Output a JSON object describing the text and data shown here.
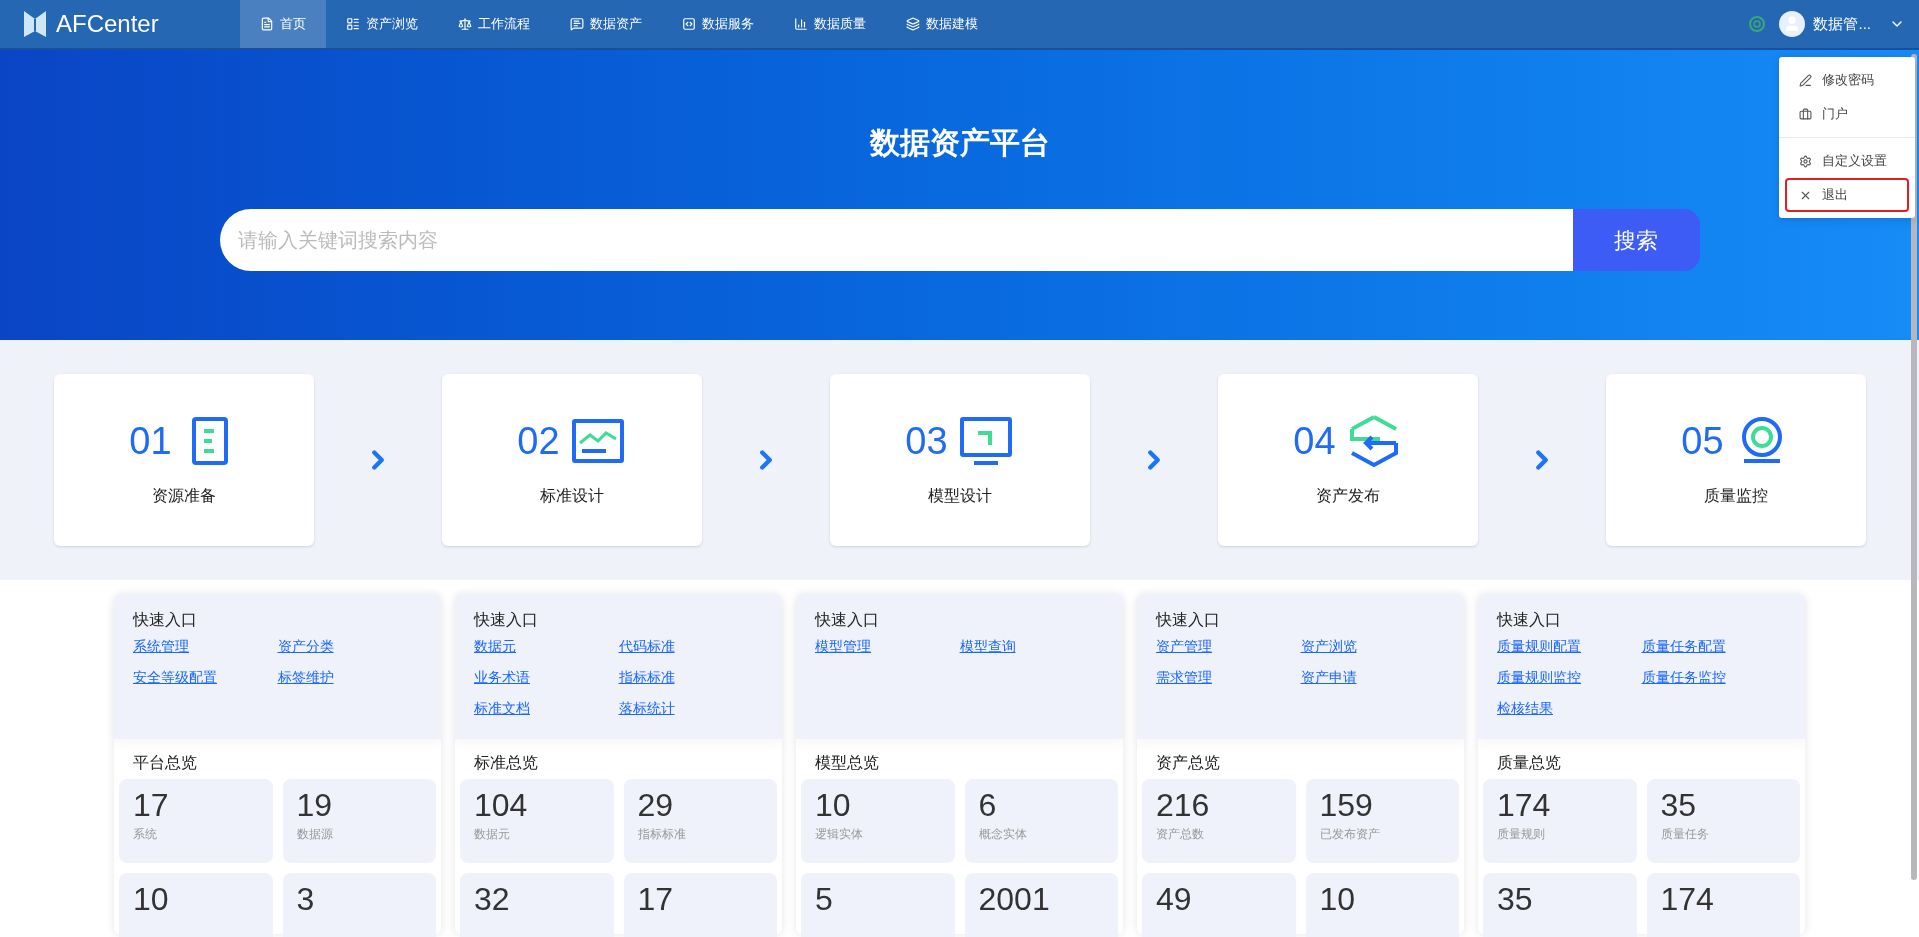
{
  "header": {
    "logo": "AFCenter",
    "nav": [
      {
        "label": "首页",
        "selected": true
      },
      {
        "label": "资产浏览",
        "selected": false
      },
      {
        "label": "工作流程",
        "selected": false
      },
      {
        "label": "数据资产",
        "selected": false
      },
      {
        "label": "数据服务",
        "selected": false
      },
      {
        "label": "数据质量",
        "selected": false
      },
      {
        "label": "数据建模",
        "selected": false
      }
    ],
    "user": {
      "name": "数据管..."
    }
  },
  "user_menu": {
    "groups": [
      [
        {
          "label": "修改密码",
          "highlighted": false
        },
        {
          "label": "门户",
          "highlighted": false
        }
      ],
      [
        {
          "label": "自定义设置",
          "highlighted": false
        },
        {
          "label": "退出",
          "highlighted": true
        }
      ]
    ]
  },
  "hero": {
    "title": "数据资产平台",
    "search": {
      "placeholder": "请输入关键词搜索内容",
      "button": "搜索"
    }
  },
  "steps": [
    {
      "number": "01",
      "label": "资源准备"
    },
    {
      "number": "02",
      "label": "标准设计"
    },
    {
      "number": "03",
      "label": "模型设计"
    },
    {
      "number": "04",
      "label": "资产发布"
    },
    {
      "number": "05",
      "label": "质量监控"
    }
  ],
  "panels": [
    {
      "quick_title": "快速入口",
      "links": [
        "系统管理",
        "资产分类",
        "安全等级配置",
        "标签维护"
      ],
      "overview_title": "平台总览",
      "stats": [
        {
          "value": "17",
          "label": "系统"
        },
        {
          "value": "19",
          "label": "数据源"
        },
        {
          "value": "10"
        },
        {
          "value": "3"
        }
      ]
    },
    {
      "quick_title": "快速入口",
      "links": [
        "数据元",
        "代码标准",
        "业务术语",
        "指标标准",
        "标准文档",
        "落标统计"
      ],
      "overview_title": "标准总览",
      "stats": [
        {
          "value": "104",
          "label": "数据元"
        },
        {
          "value": "29",
          "label": "指标标准"
        },
        {
          "value": "32"
        },
        {
          "value": "17"
        }
      ]
    },
    {
      "quick_title": "快速入口",
      "links": [
        "模型管理",
        "模型查询"
      ],
      "overview_title": "模型总览",
      "stats": [
        {
          "value": "10",
          "label": "逻辑实体"
        },
        {
          "value": "6",
          "label": "概念实体"
        },
        {
          "value": "5"
        },
        {
          "value": "2001"
        }
      ]
    },
    {
      "quick_title": "快速入口",
      "links": [
        "资产管理",
        "资产浏览",
        "需求管理",
        "资产申请"
      ],
      "overview_title": "资产总览",
      "stats": [
        {
          "value": "216",
          "label": "资产总数"
        },
        {
          "value": "159",
          "label": "已发布资产"
        },
        {
          "value": "49"
        },
        {
          "value": "10"
        }
      ]
    },
    {
      "quick_title": "快速入口",
      "links": [
        "质量规则配置",
        "质量任务配置",
        "质量规则监控",
        "质量任务监控",
        "检核结果"
      ],
      "overview_title": "质量总览",
      "stats": [
        {
          "value": "174",
          "label": "质量规则"
        },
        {
          "value": "35",
          "label": "质量任务"
        },
        {
          "value": "35"
        },
        {
          "value": "174"
        }
      ]
    }
  ]
}
